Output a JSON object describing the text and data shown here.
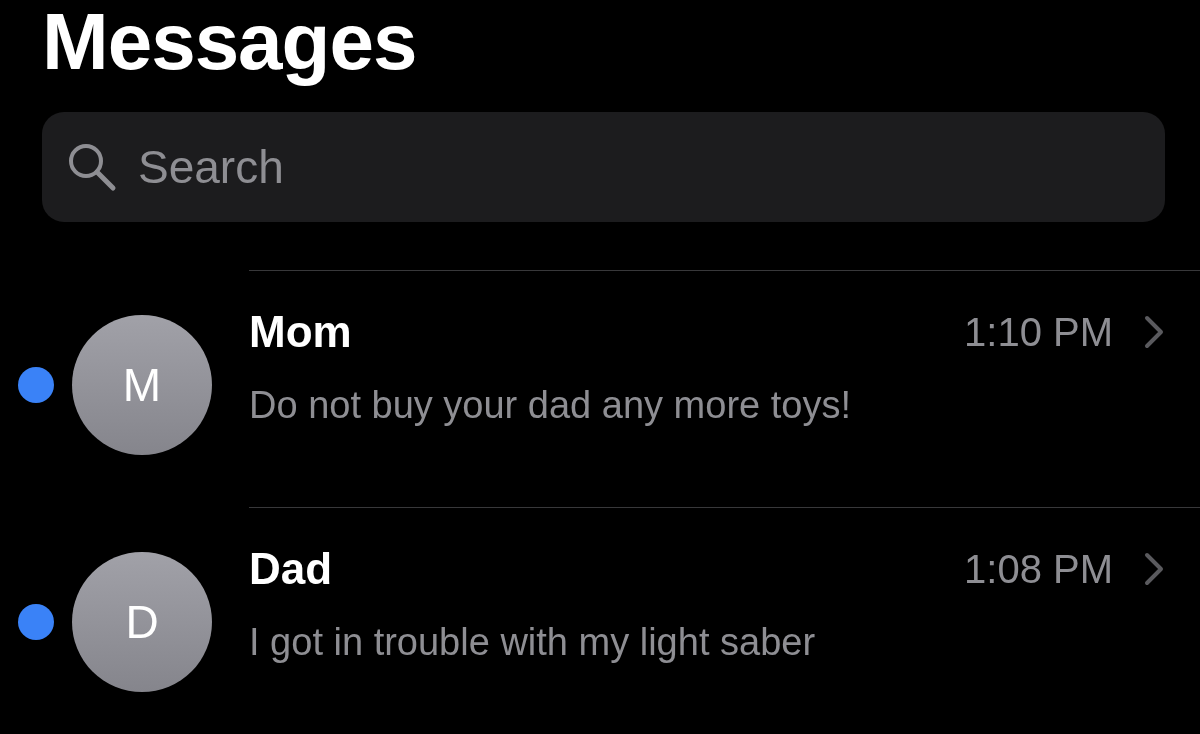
{
  "title": "Messages",
  "search": {
    "placeholder": "Search"
  },
  "conversations": [
    {
      "initial": "M",
      "name": "Mom",
      "time": "1:10 PM",
      "preview": "Do not buy your dad any more toys!",
      "unread": true
    },
    {
      "initial": "D",
      "name": "Dad",
      "time": "1:08 PM",
      "preview": "I got in trouble with my light saber",
      "unread": true
    }
  ]
}
